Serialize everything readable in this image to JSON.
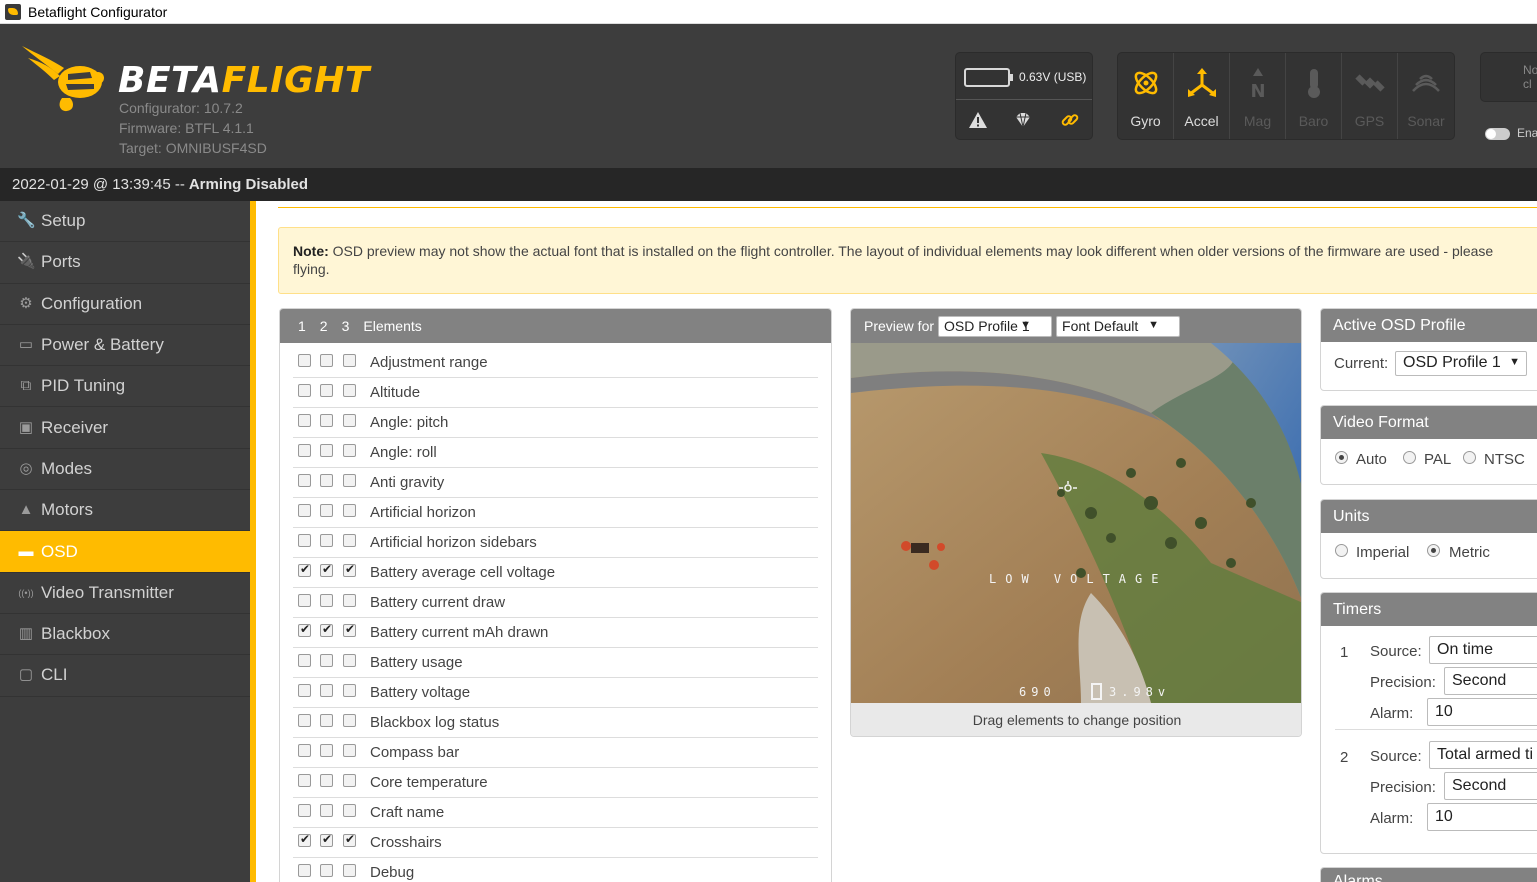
{
  "window": {
    "title": "Betaflight Configurator"
  },
  "header": {
    "logo_main": "BETA",
    "logo_accent": "FLIGHT",
    "configurator_version": "Configurator: 10.7.2",
    "firmware": "Firmware: BTFL 4.1.1",
    "target": "Target: OMNIBUSF4SD",
    "battery_voltage": "0.63V (USB)",
    "connect_label": "No\ncl",
    "expert_label": "Ena"
  },
  "sensors": [
    {
      "label": "Gyro",
      "icon": "gyro-icon",
      "active": true
    },
    {
      "label": "Accel",
      "icon": "accel-icon",
      "active": true
    },
    {
      "label": "Mag",
      "icon": "mag-icon",
      "active": false
    },
    {
      "label": "Baro",
      "icon": "baro-icon",
      "active": false
    },
    {
      "label": "GPS",
      "icon": "gps-icon",
      "active": false
    },
    {
      "label": "Sonar",
      "icon": "sonar-icon",
      "active": false
    }
  ],
  "status_bar": {
    "timestamp": "2022-01-29 @ 13:39:45 --",
    "arming": "Arming Disabled"
  },
  "sidebar": {
    "items": [
      {
        "label": "Setup",
        "icon": "wrench-icon",
        "glyph": "🔧",
        "active": false
      },
      {
        "label": "Ports",
        "icon": "plug-icon",
        "glyph": "🔌",
        "active": false
      },
      {
        "label": "Configuration",
        "icon": "gear-icon",
        "glyph": "⚙",
        "active": false
      },
      {
        "label": "Power & Battery",
        "icon": "battery-icon",
        "glyph": "▭",
        "active": false
      },
      {
        "label": "PID Tuning",
        "icon": "pid-icon",
        "glyph": "⧉",
        "active": false
      },
      {
        "label": "Receiver",
        "icon": "receiver-icon",
        "glyph": "▣",
        "active": false
      },
      {
        "label": "Modes",
        "icon": "modes-icon",
        "glyph": "◎",
        "active": false
      },
      {
        "label": "Motors",
        "icon": "motor-icon",
        "glyph": "▲",
        "active": false
      },
      {
        "label": "OSD",
        "icon": "osd-icon",
        "glyph": "▬",
        "active": true
      },
      {
        "label": "Video Transmitter",
        "icon": "vtx-icon",
        "glyph": "((•))",
        "active": false
      },
      {
        "label": "Blackbox",
        "icon": "blackbox-icon",
        "glyph": "▥",
        "active": false
      },
      {
        "label": "CLI",
        "icon": "cli-icon",
        "glyph": "▢",
        "active": false
      }
    ]
  },
  "note": {
    "prefix": "Note:",
    "text": "OSD preview may not show the actual font that is installed on the flight controller. The layout of individual elements may look different when older versions of the firmware are used - please",
    "text2": "flying."
  },
  "elements_panel": {
    "col1": "1",
    "col2": "2",
    "col3": "3",
    "title": "Elements",
    "rows": [
      {
        "label": "Adjustment range",
        "c1": false,
        "c2": false,
        "c3": false
      },
      {
        "label": "Altitude",
        "c1": false,
        "c2": false,
        "c3": false
      },
      {
        "label": "Angle: pitch",
        "c1": false,
        "c2": false,
        "c3": false
      },
      {
        "label": "Angle: roll",
        "c1": false,
        "c2": false,
        "c3": false
      },
      {
        "label": "Anti gravity",
        "c1": false,
        "c2": false,
        "c3": false
      },
      {
        "label": "Artificial horizon",
        "c1": false,
        "c2": false,
        "c3": false
      },
      {
        "label": "Artificial horizon sidebars",
        "c1": false,
        "c2": false,
        "c3": false
      },
      {
        "label": "Battery average cell voltage",
        "c1": true,
        "c2": true,
        "c3": true
      },
      {
        "label": "Battery current draw",
        "c1": false,
        "c2": false,
        "c3": false
      },
      {
        "label": "Battery current mAh drawn",
        "c1": true,
        "c2": true,
        "c3": true
      },
      {
        "label": "Battery usage",
        "c1": false,
        "c2": false,
        "c3": false
      },
      {
        "label": "Battery voltage",
        "c1": false,
        "c2": false,
        "c3": false
      },
      {
        "label": "Blackbox log status",
        "c1": false,
        "c2": false,
        "c3": false
      },
      {
        "label": "Compass bar",
        "c1": false,
        "c2": false,
        "c3": false
      },
      {
        "label": "Core temperature",
        "c1": false,
        "c2": false,
        "c3": false
      },
      {
        "label": "Craft name",
        "c1": false,
        "c2": false,
        "c3": false
      },
      {
        "label": "Crosshairs",
        "c1": true,
        "c2": true,
        "c3": true
      },
      {
        "label": "Debug",
        "c1": false,
        "c2": false,
        "c3": false
      }
    ]
  },
  "preview": {
    "label": "Preview for",
    "profile_select": "OSD Profile 1",
    "font_select": "Font Default",
    "caption": "Drag elements to change position",
    "osd_warning": "LOW VOLTAGE",
    "osd_mah": "690",
    "osd_voltage": "3.98v"
  },
  "active_profile": {
    "title": "Active OSD Profile",
    "current_label": "Current:",
    "current_value": "OSD Profile 1"
  },
  "video_format": {
    "title": "Video Format",
    "options": [
      "Auto",
      "PAL",
      "NTSC"
    ],
    "selected": "Auto"
  },
  "units": {
    "title": "Units",
    "options": [
      "Imperial",
      "Metric"
    ],
    "selected": "Metric"
  },
  "timers": {
    "title": "Timers",
    "source_label": "Source:",
    "precision_label": "Precision:",
    "alarm_label": "Alarm:",
    "items": [
      {
        "index": "1",
        "source": "On time",
        "precision": "Second",
        "alarm": "10"
      },
      {
        "index": "2",
        "source": "Total armed ti",
        "precision": "Second",
        "alarm": "10"
      }
    ]
  },
  "alarms": {
    "title": "Alarms"
  },
  "colors": {
    "accent": "#ffbb00",
    "header_bg": "#3d3d3d",
    "sidebar_bg": "#3d3d3d",
    "panel_head": "#828282"
  }
}
